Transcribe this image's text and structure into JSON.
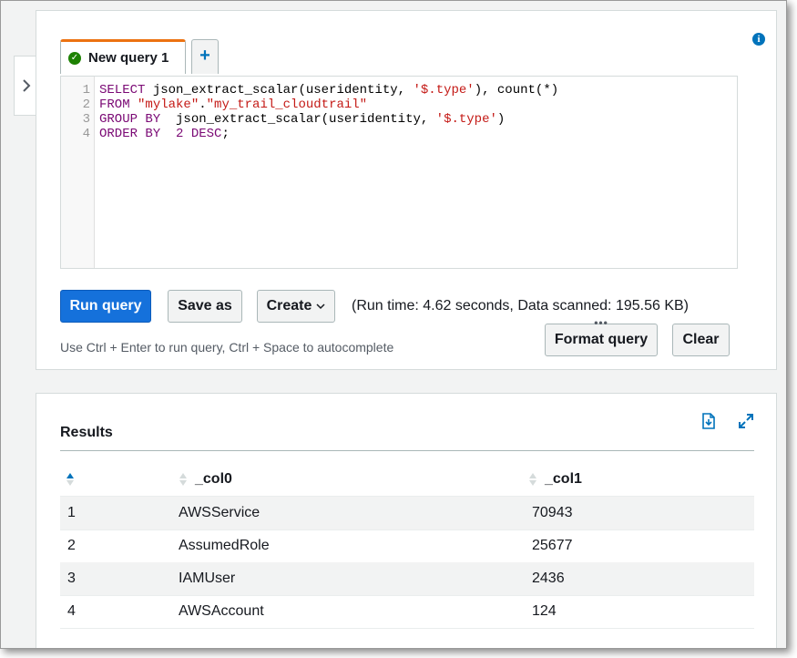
{
  "editor": {
    "tab": {
      "label": "New query 1"
    },
    "add_tab_symbol": "+",
    "sql_lines": [
      {
        "no": "1",
        "parts": [
          {
            "t": "SELECT",
            "k": "kw"
          },
          {
            "t": " json_extract_scalar(useridentity, ",
            "k": ""
          },
          {
            "t": "'$.type'",
            "k": "str"
          },
          {
            "t": "), count(*)",
            "k": ""
          }
        ]
      },
      {
        "no": "2",
        "parts": [
          {
            "t": "FROM",
            "k": "kw"
          },
          {
            "t": " ",
            "k": ""
          },
          {
            "t": "\"mylake\"",
            "k": "str"
          },
          {
            "t": ".",
            "k": ""
          },
          {
            "t": "\"my_trail_cloudtrail\"",
            "k": "str"
          }
        ]
      },
      {
        "no": "3",
        "parts": [
          {
            "t": "GROUP BY",
            "k": "kw"
          },
          {
            "t": "  json_extract_scalar(useridentity, ",
            "k": ""
          },
          {
            "t": "'$.type'",
            "k": "str"
          },
          {
            "t": ")",
            "k": ""
          }
        ]
      },
      {
        "no": "4",
        "parts": [
          {
            "t": "ORDER BY",
            "k": "kw"
          },
          {
            "t": "  ",
            "k": ""
          },
          {
            "t": "2 DESC",
            "k": "kw"
          },
          {
            "t": ";",
            "k": ""
          }
        ]
      }
    ]
  },
  "toolbar": {
    "run_label": "Run query",
    "save_label": "Save as",
    "create_label": "Create",
    "format_label": "Format query",
    "clear_label": "Clear"
  },
  "run_info": "(Run time: 4.62 seconds, Data scanned: 195.56 KB)",
  "hint": "Use Ctrl + Enter to run query, Ctrl + Space to autocomplete",
  "results": {
    "title": "Results",
    "columns": [
      "_col0",
      "_col1"
    ],
    "rows": [
      [
        "1",
        "AWSService",
        "70943"
      ],
      [
        "2",
        "AssumedRole",
        "25677"
      ],
      [
        "3",
        "IAMUser",
        "2436"
      ],
      [
        "4",
        "AWSAccount",
        "124"
      ]
    ]
  },
  "icons": {
    "tab_status": "check-circle-icon",
    "side_toggle": "chevron-right-icon",
    "info": "info-icon",
    "download": "download-csv-icon",
    "expand": "expand-icon",
    "sort": "sort-icon"
  },
  "colors": {
    "primary": "#1571db",
    "tab_accent": "#ec7211",
    "success": "#1d8102",
    "link": "#0073bb"
  }
}
